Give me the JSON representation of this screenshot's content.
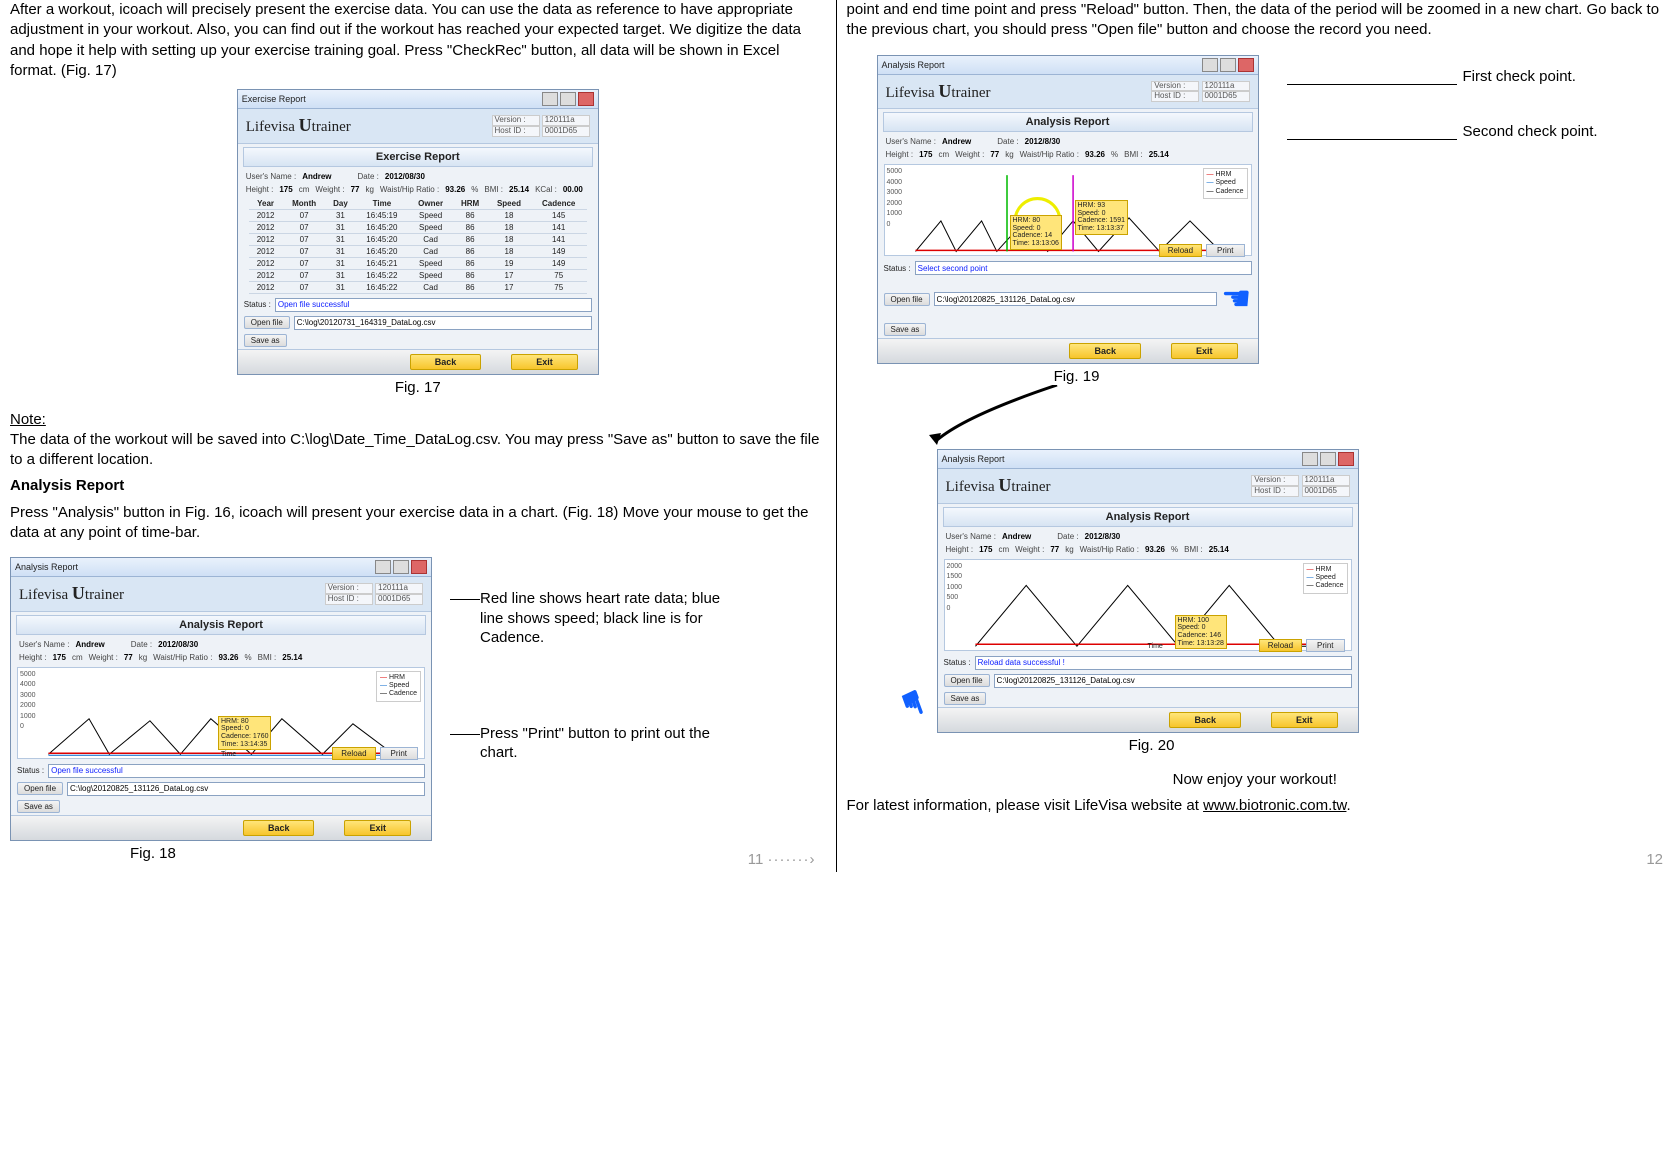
{
  "left": {
    "para1": "After a workout, icoach will precisely present the exercise data.  You can use the data as reference to have appropriate adjustment in your workout.  Also, you can find out if the workout has reached your expected target.  We digitize the data and hope it help with setting up your exercise training goal.  Press \"CheckRec\" button, all data will be shown in Excel format. (Fig. 17)",
    "note_label": "Note:",
    "note_text": "The data of the workout will be saved into C:\\log\\Date_Time_DataLog.csv.  You may press \"Save as\" button to save the file to a different location.",
    "ar_heading": "Analysis Report",
    "ar_text": "Press \"Analysis\" button in Fig. 16, icoach will present your exercise data in a chart.  (Fig. 18)  Move your mouse to get the data at any point of time-bar.",
    "annot1": "Red line shows heart rate data; blue line shows speed; black line is for Cadence.",
    "annot2": "Press \"Print\" button to print out the chart.",
    "fig17": "Fig. 17",
    "fig18": "Fig. 18",
    "page": "11",
    "dots": "·······›"
  },
  "right": {
    "para1": "point and end time point and press \"Reload\" button.  Then, the data of the period will be zoomed in a new chart.  Go back to the previous chart, you should press \"Open file\" button and choose the record you need.",
    "annot1": "First check point.",
    "annot2": "Second check point.",
    "fig19": "Fig. 19",
    "fig20": "Fig. 20",
    "enjoy": "Now enjoy your workout!",
    "latest": "For latest information, please visit LifeVisa website at ",
    "url": "www.biotronic.com.tw",
    "page": "12"
  },
  "win": {
    "title_exercise": "Exercise Report",
    "title_analysis": "Analysis Report",
    "app_title": "Analysis Report",
    "brand_a": "Lifevisa ",
    "brand_u": "U",
    "brand_b": "trainer",
    "version_lbl": "Version :",
    "version_v": "120111a",
    "host_lbl": "Host ID :",
    "host_v": "0001D65",
    "report_ex": "Exercise Report",
    "report_an": "Analysis Report",
    "info_user_lbl": "User's Name :",
    "info_user": "Andrew",
    "info_date_lbl": "Date :",
    "info_date": "2012/08/30",
    "info_date2": "2012/8/30",
    "info_height_lbl": "Height :",
    "info_height": "175",
    "info_height_u": "cm",
    "info_weight_lbl": "Weight :",
    "info_weight": "77",
    "info_weight_u": "kg",
    "info_whr_lbl": "Waist/Hip Ratio :",
    "info_whr": "93.26",
    "info_whr_u": "%",
    "info_bmi_lbl": "BMI :",
    "info_bmi": "25.14",
    "info_kcal_lbl": "KCal :",
    "info_kcal": "00.00",
    "tbl_headers": [
      "Year",
      "Month",
      "Day",
      "Time",
      "Owner",
      "HRM",
      "Speed",
      "Cadence"
    ],
    "tbl_rows": [
      [
        "2012",
        "07",
        "31",
        "16:45:19",
        "Speed",
        "86",
        "18",
        "145"
      ],
      [
        "2012",
        "07",
        "31",
        "16:45:20",
        "Speed",
        "86",
        "18",
        "141"
      ],
      [
        "2012",
        "07",
        "31",
        "16:45:20",
        "Cad",
        "86",
        "18",
        "141"
      ],
      [
        "2012",
        "07",
        "31",
        "16:45:20",
        "Cad",
        "86",
        "18",
        "149"
      ],
      [
        "2012",
        "07",
        "31",
        "16:45:21",
        "Speed",
        "86",
        "19",
        "149"
      ],
      [
        "2012",
        "07",
        "31",
        "16:45:22",
        "Speed",
        "86",
        "17",
        "75"
      ],
      [
        "2012",
        "07",
        "31",
        "16:45:22",
        "Cad",
        "86",
        "17",
        "75"
      ]
    ],
    "status_lbl": "Status :",
    "status_open": "Open file successful",
    "status_select": "Select second point",
    "status_reload": "Reload data successful !",
    "openfile": "Open file",
    "saveas": "Save as",
    "path1": "C:\\log\\20120731_164319_DataLog.csv",
    "path2": "C:\\log\\20120825_131126_DataLog.csv",
    "back": "Back",
    "exit": "Exit",
    "reload": "Reload",
    "print": "Print",
    "legend_hrm": "HRM",
    "legend_speed": "Speed",
    "legend_cadence": "Cadence",
    "time_lbl": "Time",
    "tip18_l1": "HRM: 80",
    "tip18_l2": "Speed: 0",
    "tip18_l3": "Cadence: 1760",
    "tip18_l4": "Time: 13:14:35",
    "tip19a_l1": "HRM: 93",
    "tip19a_l2": "Speed: 0",
    "tip19a_l3": "Cadence: 1591",
    "tip19a_l4": "Time: 13:13:37",
    "tip19b_l1": "HRM: 80",
    "tip19b_l2": "Speed: 0",
    "tip19b_l3": "Cadence: 14",
    "tip19b_l4": "Time: 13:13:06",
    "tip20_l1": "HRM: 100",
    "tip20_l2": "Speed: 0",
    "tip20_l3": "Cadence: 146",
    "tip20_l4": "Time: 13:13:28"
  },
  "chart_data": [
    {
      "id": "fig18",
      "type": "line",
      "title": "Analysis Report",
      "xlabel": "Time",
      "ylabel": "",
      "ylim": [
        0,
        5000
      ],
      "yticks": [
        0,
        1000,
        2000,
        3000,
        4000,
        5000
      ],
      "series": [
        {
          "name": "HRM",
          "color": "#d00",
          "values": [
            80,
            85,
            82,
            90,
            88,
            80,
            80
          ]
        },
        {
          "name": "Speed",
          "color": "#06c",
          "values": [
            0,
            0,
            0,
            0,
            0,
            0,
            0
          ]
        },
        {
          "name": "Cadence",
          "color": "#000",
          "values": [
            0,
            1800,
            0,
            1700,
            0,
            1760,
            0
          ]
        }
      ]
    },
    {
      "id": "fig19",
      "type": "line",
      "title": "Analysis Report",
      "xlabel": "Time",
      "ylabel": "",
      "ylim": [
        0,
        5000
      ],
      "yticks": [
        0,
        1000,
        2000,
        3000,
        4000,
        5000
      ],
      "series": [
        {
          "name": "HRM",
          "color": "#d00",
          "values": [
            80,
            93,
            82,
            80,
            90,
            80,
            80
          ]
        },
        {
          "name": "Speed",
          "color": "#06c",
          "values": [
            0,
            0,
            0,
            0,
            0,
            0,
            0
          ]
        },
        {
          "name": "Cadence",
          "color": "#000",
          "values": [
            0,
            1600,
            0,
            1591,
            0,
            1400,
            0
          ]
        }
      ]
    },
    {
      "id": "fig20",
      "type": "line",
      "title": "Analysis Report",
      "xlabel": "Time",
      "ylabel": "",
      "ylim": [
        0,
        2000
      ],
      "yticks": [
        0,
        500,
        1000,
        1500,
        2000
      ],
      "series": [
        {
          "name": "HRM",
          "color": "#d00",
          "values": [
            90,
            100,
            95,
            92,
            100,
            98,
            90
          ]
        },
        {
          "name": "Speed",
          "color": "#06c",
          "values": [
            0,
            0,
            0,
            0,
            0,
            0,
            0
          ]
        },
        {
          "name": "Cadence",
          "color": "#000",
          "values": [
            0,
            1500,
            0,
            1400,
            0,
            146,
            0
          ]
        }
      ]
    }
  ]
}
